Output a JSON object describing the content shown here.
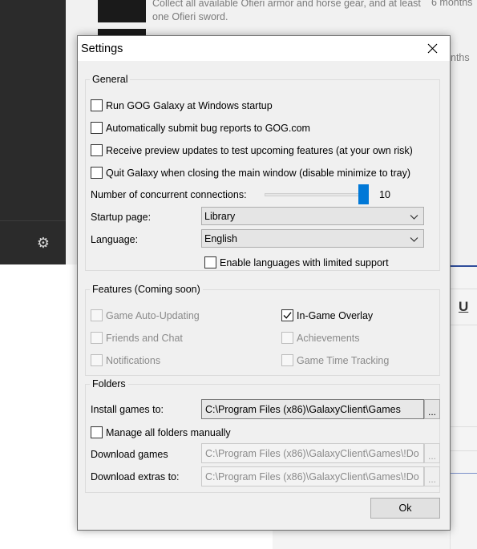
{
  "background": {
    "item_text": "Collect all available Ofieri armor and horse gear, and at least one Ofieri sword.",
    "item_time": "6 months",
    "item_time2": "nths",
    "side_icon": "gear-icon"
  },
  "dialog": {
    "title": "Settings",
    "close_icon": "close-icon",
    "general": {
      "label": "General",
      "run_at_startup": "Run GOG Galaxy at Windows startup",
      "submit_bug_reports": "Automatically submit bug reports to GOG.com",
      "preview_updates": "Receive preview updates to test upcoming features (at your own risk)",
      "quit_on_close": "Quit Galaxy when closing the main window (disable minimize to tray)",
      "connections_label": "Number of concurrent connections:",
      "connections_value": "10",
      "connections_fraction": 1.0,
      "startup_page_label": "Startup page:",
      "startup_page_value": "Library",
      "language_label": "Language:",
      "language_value": "English",
      "limited_languages": "Enable languages with limited support"
    },
    "features": {
      "label": "Features (Coming soon)",
      "auto_updating": "Game Auto-Updating",
      "in_game_overlay": "In-Game Overlay",
      "friends_chat": "Friends and Chat",
      "achievements": "Achievements",
      "notifications": "Notifications",
      "time_tracking": "Game Time Tracking"
    },
    "folders": {
      "label": "Folders",
      "install_label": "Install games to:",
      "install_path": "C:\\Program Files (x86)\\GalaxyClient\\Games",
      "manage_manually": "Manage all folders manually",
      "download_games_label": "Download games",
      "download_games_path": "C:\\Program Files (x86)\\GalaxyClient\\Games\\!Do",
      "download_extras_label": "Download extras to:",
      "download_extras_path": "C:\\Program Files (x86)\\GalaxyClient\\Games\\!Do",
      "browse_label": "..."
    },
    "ok_label": "Ok"
  }
}
